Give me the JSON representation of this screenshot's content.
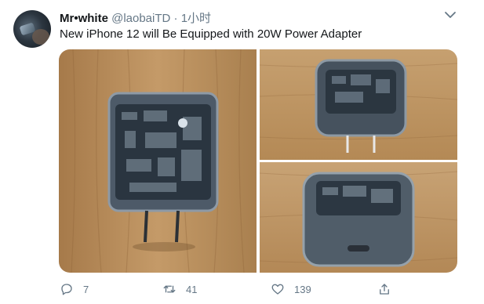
{
  "tweet": {
    "display_name": "Mr•white",
    "handle": "@laobaiTD",
    "separator": "·",
    "time": "1小时",
    "text": "New iPhone 12 will Be Equipped with 20W Power Adapter",
    "media": [
      {
        "description": "translucent power adapter front view"
      },
      {
        "description": "translucent power adapter side view with prongs"
      },
      {
        "description": "translucent power adapter bottom view"
      }
    ]
  },
  "actions": {
    "reply": {
      "icon": "reply-icon",
      "count": "7"
    },
    "retweet": {
      "icon": "retweet-icon",
      "count": "41"
    },
    "like": {
      "icon": "heart-icon",
      "count": "139"
    },
    "share": {
      "icon": "share-icon"
    }
  },
  "colors": {
    "text_primary": "#14171a",
    "text_secondary": "#657786",
    "wood": "#b98c5c"
  }
}
